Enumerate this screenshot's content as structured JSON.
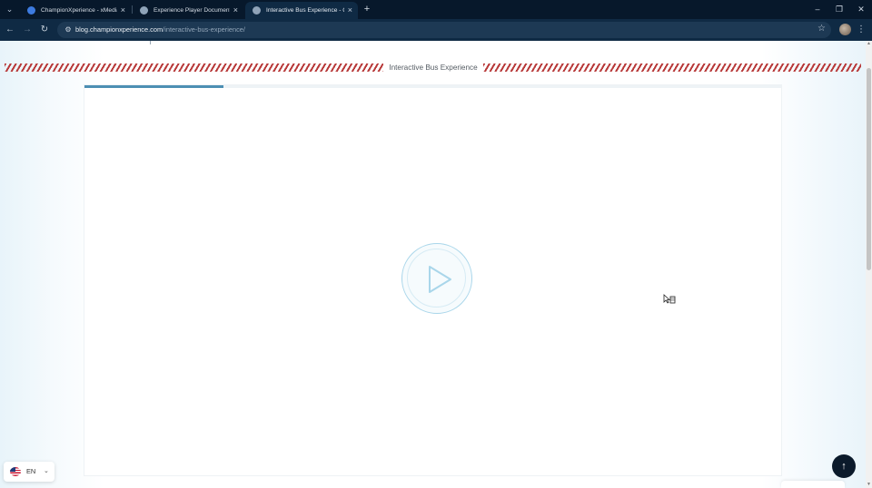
{
  "browser": {
    "tabs": [
      {
        "title": "ChampionXperience - xMedia",
        "favicon_color": "#3d7be0",
        "active": false
      },
      {
        "title": "Experience Player Documentation",
        "favicon_color": "#8fa3b8",
        "active": false
      },
      {
        "title": "Interactive Bus Experience - Cham",
        "favicon_color": "#8fa3b8",
        "active": true
      }
    ],
    "new_tab_icon": "+",
    "window_controls": {
      "minimize": "–",
      "restore": "❐",
      "close": "✕"
    },
    "nav": {
      "back": "←",
      "forward": "→",
      "reload": "↻"
    },
    "url": {
      "domain": "blog.championxperience.com",
      "path": "/interactive-bus-experience/"
    },
    "bookmark_icon": "☆",
    "menu_icon": "⋮"
  },
  "page": {
    "banner_title": "Interactive Bus Experience",
    "player": {
      "progress_fraction": 0.2
    },
    "language": {
      "code": "EN",
      "caret": "⌄"
    },
    "back_to_top_icon": "↑"
  },
  "colors": {
    "chrome_dark": "#07182b",
    "toolbar": "#0f2a44",
    "banner_stripe": "#b83a3a",
    "progress": "#4d8fb3",
    "play_ring": "#a9d6ea"
  }
}
